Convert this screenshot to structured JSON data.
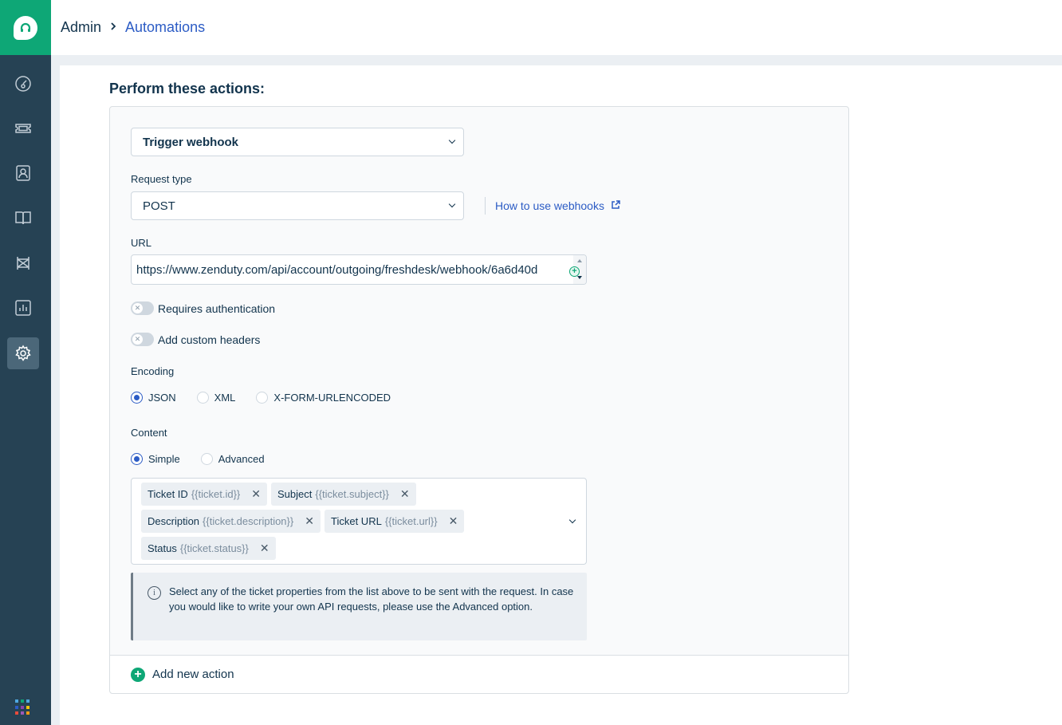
{
  "header": {
    "breadcrumb_root": "Admin",
    "breadcrumb_current": "Automations"
  },
  "sidebar": {
    "items": [
      {
        "icon": "dashboard-icon"
      },
      {
        "icon": "ticket-icon"
      },
      {
        "icon": "contacts-icon"
      },
      {
        "icon": "solutions-book-icon"
      },
      {
        "icon": "forums-icon"
      },
      {
        "icon": "reports-icon"
      },
      {
        "icon": "admin-gear-icon",
        "active": true
      }
    ]
  },
  "main": {
    "section_title": "Perform these actions:",
    "action": {
      "type_value": "Trigger webhook",
      "request_type_label": "Request type",
      "request_type_value": "POST",
      "help_link": "How to use webhooks",
      "url_label": "URL",
      "url_value": "https://www.zenduty.com/api/account/outgoing/freshdesk/webhook/6a6d40d",
      "requires_auth_label": "Requires authentication",
      "custom_headers_label": "Add custom headers",
      "encoding_label": "Encoding",
      "encoding_options": [
        "JSON",
        "XML",
        "X-FORM-URLENCODED"
      ],
      "encoding_selected": "JSON",
      "content_label": "Content",
      "content_options": [
        "Simple",
        "Advanced"
      ],
      "content_selected": "Simple",
      "tags": [
        {
          "name": "Ticket ID",
          "placeholder": "{{ticket.id}}"
        },
        {
          "name": "Subject",
          "placeholder": "{{ticket.subject}}"
        },
        {
          "name": "Description",
          "placeholder": "{{ticket.description}}"
        },
        {
          "name": "Ticket URL",
          "placeholder": "{{ticket.url}}"
        },
        {
          "name": "Status",
          "placeholder": "{{ticket.status}}"
        }
      ],
      "info_text": "Select any of the ticket properties from the list above to be sent with the request. In case you would like to write your own API requests, please use the Advanced option."
    },
    "add_action_label": "Add new action"
  },
  "colors": {
    "brand_green": "#0ea776",
    "sidebar_bg": "#264254",
    "link_blue": "#2c5cc5"
  }
}
